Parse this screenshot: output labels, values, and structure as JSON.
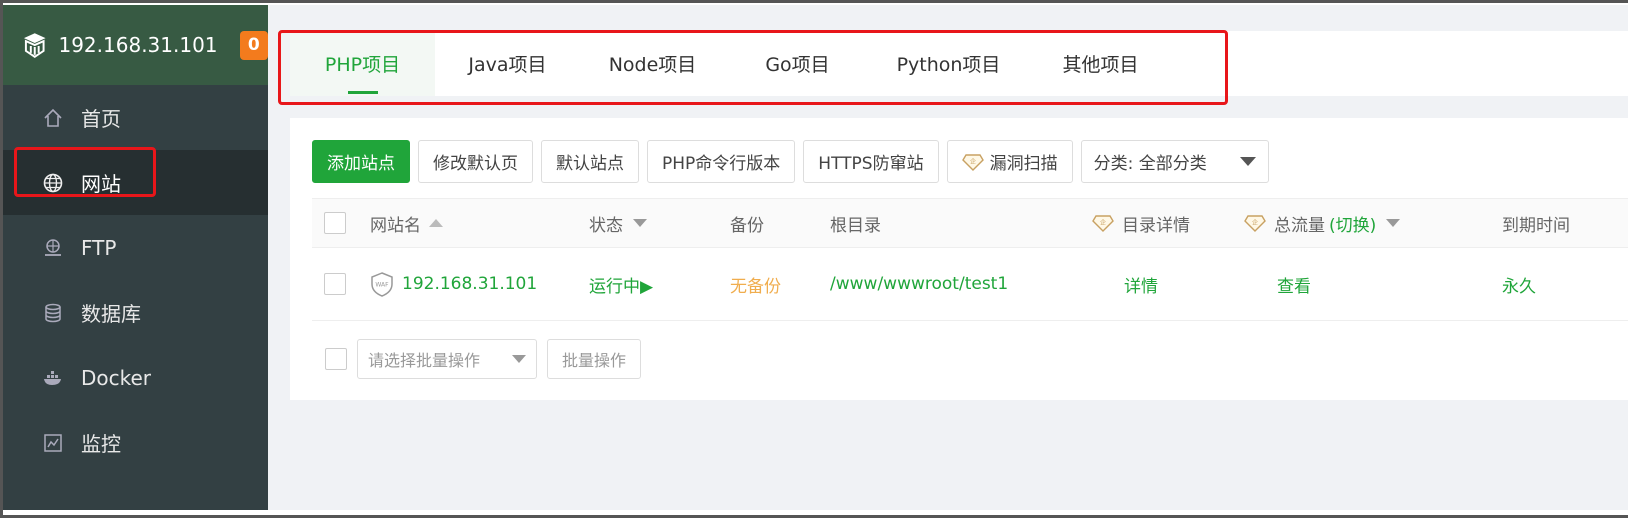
{
  "sidebar": {
    "server_ip": "192.168.31.101",
    "badge_count": "0",
    "items": [
      {
        "label": "首页",
        "icon": "home-icon"
      },
      {
        "label": "网站",
        "icon": "globe-icon"
      },
      {
        "label": "FTP",
        "icon": "ftp-icon"
      },
      {
        "label": "数据库",
        "icon": "database-icon"
      },
      {
        "label": "Docker",
        "icon": "docker-icon"
      },
      {
        "label": "监控",
        "icon": "monitor-icon"
      }
    ]
  },
  "tabs": [
    "PHP项目",
    "Java项目",
    "Node项目",
    "Go项目",
    "Python项目",
    "其他项目"
  ],
  "toolbar": {
    "add_site": "添加站点",
    "edit_default_page": "修改默认页",
    "default_site": "默认站点",
    "php_cli_version": "PHP命令行版本",
    "https_anti_intrusion": "HTTPS防窜站",
    "vuln_scan": "漏洞扫描",
    "category_select": "分类: 全部分类"
  },
  "table": {
    "headers": {
      "site_name": "网站名",
      "status": "状态",
      "backup": "备份",
      "root_dir": "根目录",
      "dir_details": "目录详情",
      "total_traffic": "总流量",
      "switch": "(切换)",
      "expiry": "到期时间"
    },
    "rows": [
      {
        "site_name": "192.168.31.101",
        "waf_label": "WAF",
        "status": "运行中▶",
        "backup": "无备份",
        "root_dir": "/www/wwwroot/test1",
        "dir_details": "详情",
        "traffic": "查看",
        "expiry": "永久"
      }
    ]
  },
  "batch": {
    "select_placeholder": "请选择批量操作",
    "button": "批量操作"
  },
  "colors": {
    "accent": "#20a53a",
    "sidebar_bg": "#334043",
    "sidebar_header_bg": "#375a43",
    "badge": "#f37b1d",
    "highlight": "#e8161a"
  }
}
